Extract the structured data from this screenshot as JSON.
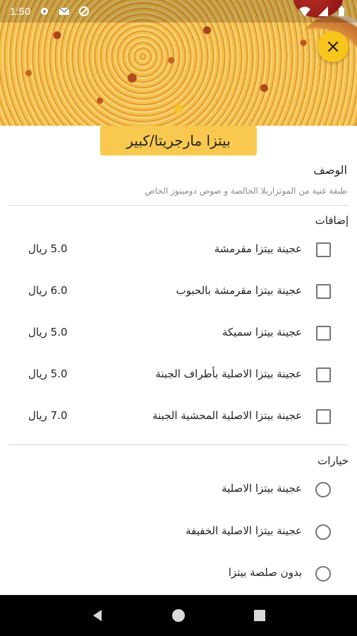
{
  "status": {
    "time": "1:50"
  },
  "title": "بيتزا مارجريتا/كبير",
  "description": {
    "heading": "الوصف",
    "text": "طبقة غنية من الموتزاريلا الخالصة و صوص دومينوز الخاص"
  },
  "addons": {
    "heading": "إضافات",
    "items": [
      {
        "label": "عجينة بيتزا مقرمشة",
        "price": "5.0 ريال"
      },
      {
        "label": "عجينة بيتزا مقرمشة بالحبوب",
        "price": "6.0 ريال"
      },
      {
        "label": "عجينة بيتزا سميكة",
        "price": "5.0 ريال"
      },
      {
        "label": "عجينة بيتزا الاصلية بأطراف الجبنة",
        "price": "5.0 ريال"
      },
      {
        "label": "عجينة بيتزا الاصلية المحشية الجبنة",
        "price": "7.0 ريال"
      }
    ]
  },
  "options": {
    "heading": "خيارات",
    "items": [
      {
        "label": "عجينة بيتزا الاصلية"
      },
      {
        "label": "عجينة بيتزا الاصلية الخفيفة"
      },
      {
        "label": "بدون صلصة بيتزا"
      }
    ]
  },
  "colors": {
    "accent": "#f7c51b",
    "title_badge": "#f8c94e"
  },
  "icons": {
    "close": "close-icon",
    "back": "nav-back-icon",
    "home": "nav-home-icon",
    "recents": "nav-recents-icon"
  }
}
